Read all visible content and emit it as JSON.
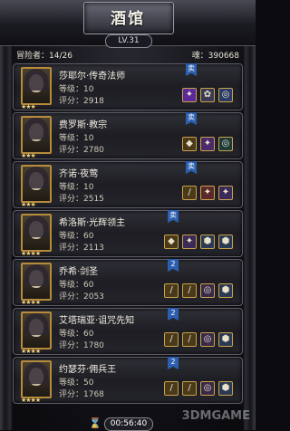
{
  "window": {
    "title": "酒馆",
    "level": "LV.31"
  },
  "stats": {
    "adventurers": "冒险者：14/26",
    "souls": "魂：390668"
  },
  "heroes": [
    {
      "name": "莎耶尔·传奇法师",
      "level": "等级：10",
      "score": "评分：2918",
      "stars": 3,
      "badge": "卖",
      "badge_color": "#2c5fb0",
      "equip": [
        "✦",
        "✿",
        "◎"
      ],
      "equip_colors": [
        "#5a2a9a",
        "#3a3a55",
        "#2a3a66"
      ]
    },
    {
      "name": "费罗斯·教宗",
      "level": "等级：10",
      "score": "评分：2780",
      "stars": 3,
      "badge": "卖",
      "badge_color": "#2c5fb0",
      "equip": [
        "◆",
        "✦",
        "◎"
      ],
      "equip_colors": [
        "#4a3a1a",
        "#4a2a6a",
        "#1c3a3a"
      ]
    },
    {
      "name": "齐诺·夜莺",
      "level": "等级：10",
      "score": "评分：2515",
      "stars": 3,
      "badge": "卖",
      "badge_color": "#2c5fb0",
      "equip": [
        "/",
        "✦",
        "✦"
      ],
      "equip_colors": [
        "#4a3a1a",
        "#5a2a2a",
        "#3a2a5a"
      ]
    },
    {
      "name": "希洛斯·光辉领主",
      "level": "等级：60",
      "score": "评分：2113",
      "stars": 4,
      "badge": "卖",
      "badge_color": "#2c5fb0",
      "equip": [
        "◆",
        "✦",
        "⬢",
        "⬢"
      ],
      "equip_colors": [
        "#4a3a1a",
        "#3a2a55",
        "#2a3a55",
        "#2a3a55"
      ]
    },
    {
      "name": "乔希·剑圣",
      "level": "等级：60",
      "score": "评分：2053",
      "stars": 4,
      "badge": "2",
      "badge_color": "#2c5fb0",
      "equip": [
        "/",
        "/",
        "◎",
        "⬢"
      ],
      "equip_colors": [
        "#4a3a1a",
        "#4a3a1a",
        "#3a2a4a",
        "#2a3a55"
      ]
    },
    {
      "name": "艾塔瑞亚·诅咒先知",
      "level": "等级：60",
      "score": "评分：1780",
      "stars": 4,
      "badge": "2",
      "badge_color": "#2c5fb0",
      "equip": [
        "/",
        "/",
        "◎",
        "⬢"
      ],
      "equip_colors": [
        "#4a3a1a",
        "#4a3a1a",
        "#3a2a4a",
        "#2a3a55"
      ]
    },
    {
      "name": "约瑟芬·佣兵王",
      "level": "等级：50",
      "score": "评分：1768",
      "stars": 4,
      "badge": "2",
      "badge_color": "#2c5fb0",
      "equip": [
        "/",
        "/",
        "◎",
        "⬢"
      ],
      "equip_colors": [
        "#4a3a1a",
        "#4a3a1a",
        "#3a2a4a",
        "#2a3a55"
      ]
    }
  ],
  "timer": "00:56:40",
  "watermark": "3DMGAME"
}
